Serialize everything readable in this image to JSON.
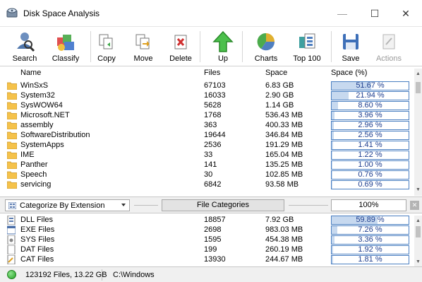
{
  "window": {
    "title": "Disk Space Analysis",
    "minimize_glyph": "—",
    "maximize_glyph": "☐",
    "close_glyph": "✕"
  },
  "toolbar": {
    "buttons": [
      {
        "label": "Search",
        "icon": "search-user-icon",
        "enabled": true
      },
      {
        "label": "Classify",
        "icon": "classify-icon",
        "enabled": true
      },
      {
        "label": "Copy",
        "icon": "copy-icon",
        "enabled": true
      },
      {
        "label": "Move",
        "icon": "move-icon",
        "enabled": true
      },
      {
        "label": "Delete",
        "icon": "delete-icon",
        "enabled": true
      },
      {
        "label": "Up",
        "icon": "up-arrow-icon",
        "enabled": true
      },
      {
        "label": "Charts",
        "icon": "pie-chart-icon",
        "enabled": true
      },
      {
        "label": "Top 100",
        "icon": "top100-icon",
        "enabled": true
      },
      {
        "label": "Save",
        "icon": "save-icon",
        "enabled": true
      },
      {
        "label": "Actions",
        "icon": "actions-icon",
        "enabled": false
      }
    ]
  },
  "folder_list": {
    "headers": {
      "name": "Name",
      "files": "Files",
      "space": "Space",
      "space_pct": "Space (%)"
    },
    "rows": [
      {
        "name": "WinSxS",
        "files": "67103",
        "space": "6.83 GB",
        "pct": "51.67 %",
        "pct_value": 51.67
      },
      {
        "name": "System32",
        "files": "16033",
        "space": "2.90 GB",
        "pct": "21.94 %",
        "pct_value": 21.94
      },
      {
        "name": "SysWOW64",
        "files": "5628",
        "space": "1.14 GB",
        "pct": "8.60 %",
        "pct_value": 8.6
      },
      {
        "name": "Microsoft.NET",
        "files": "1768",
        "space": "536.43 MB",
        "pct": "3.96 %",
        "pct_value": 3.96
      },
      {
        "name": "assembly",
        "files": "363",
        "space": "400.33 MB",
        "pct": "2.96 %",
        "pct_value": 2.96
      },
      {
        "name": "SoftwareDistribution",
        "files": "19644",
        "space": "346.84 MB",
        "pct": "2.56 %",
        "pct_value": 2.56
      },
      {
        "name": "SystemApps",
        "files": "2536",
        "space": "191.29 MB",
        "pct": "1.41 %",
        "pct_value": 1.41
      },
      {
        "name": "IME",
        "files": "33",
        "space": "165.04 MB",
        "pct": "1.22 %",
        "pct_value": 1.22
      },
      {
        "name": "Panther",
        "files": "141",
        "space": "135.25 MB",
        "pct": "1.00 %",
        "pct_value": 1.0
      },
      {
        "name": "Speech",
        "files": "30",
        "space": "102.85 MB",
        "pct": "0.76 %",
        "pct_value": 0.76
      },
      {
        "name": "servicing",
        "files": "6842",
        "space": "93.58 MB",
        "pct": "0.69 %",
        "pct_value": 0.69
      }
    ]
  },
  "category_bar": {
    "selector": "Categorize By Extension",
    "label": "File Categories",
    "percent": "100%"
  },
  "category_list": {
    "rows": [
      {
        "name": "DLL Files",
        "icon": "dll-file-icon",
        "files": "18857",
        "space": "7.92 GB",
        "pct": "59.89 %",
        "pct_value": 59.89
      },
      {
        "name": "EXE Files",
        "icon": "exe-file-icon",
        "files": "2698",
        "space": "983.03 MB",
        "pct": "7.26 %",
        "pct_value": 7.26
      },
      {
        "name": "SYS Files",
        "icon": "sys-file-icon",
        "files": "1595",
        "space": "454.38 MB",
        "pct": "3.36 %",
        "pct_value": 3.36
      },
      {
        "name": "DAT Files",
        "icon": "dat-file-icon",
        "files": "199",
        "space": "260.19 MB",
        "pct": "1.92 %",
        "pct_value": 1.92
      },
      {
        "name": "CAT Files",
        "icon": "cat-file-icon",
        "files": "13930",
        "space": "244.67 MB",
        "pct": "1.81 %",
        "pct_value": 1.81
      }
    ]
  },
  "status": {
    "summary": "123192 Files, 13.22 GB",
    "path": "C:\\Windows"
  },
  "colors": {
    "bar_border": "#4a7fc1",
    "bar_fill": "#c7d9ef",
    "pct_text": "#1f3f8f",
    "folder": "#f5c24a"
  }
}
